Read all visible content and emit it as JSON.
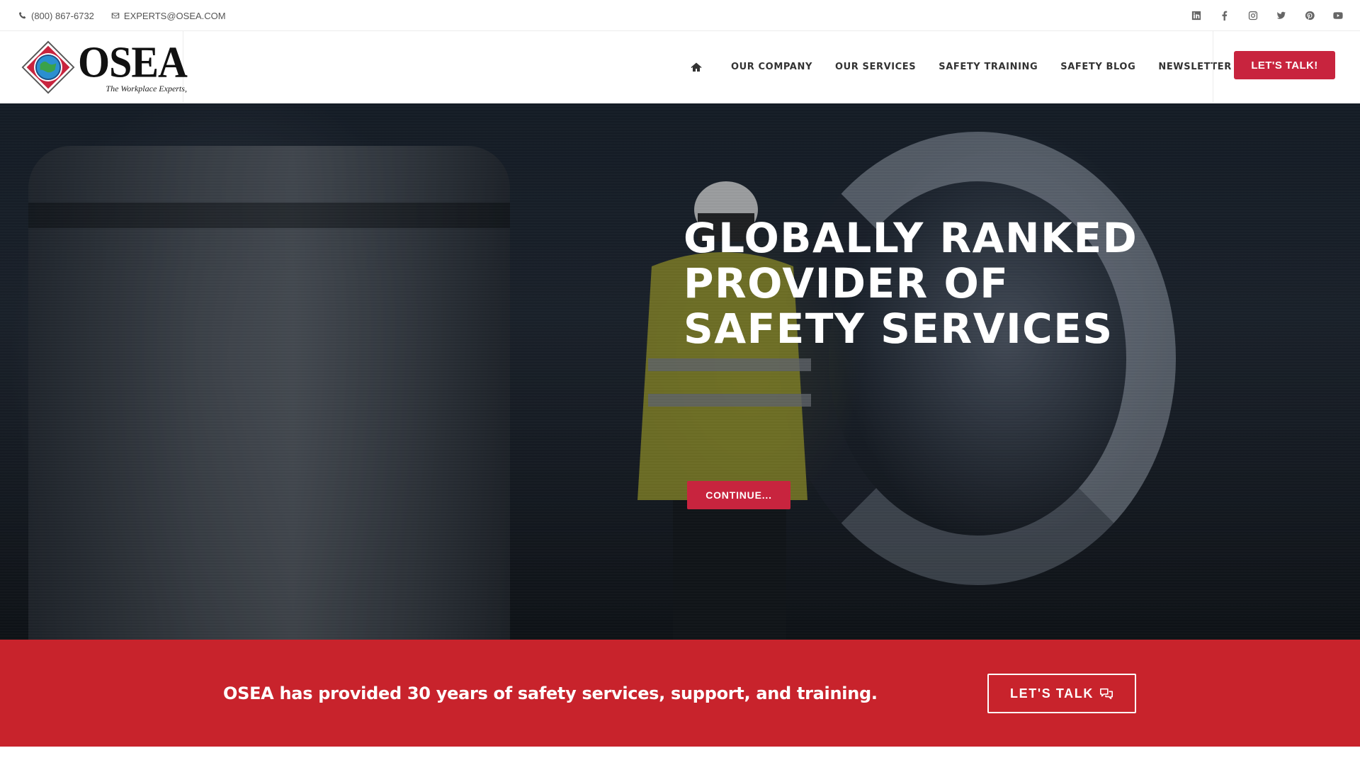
{
  "topbar": {
    "phone": "(800) 867-6732",
    "email": "EXPERTS@OSEA.COM",
    "social": [
      "linkedin-icon",
      "facebook-icon",
      "instagram-icon",
      "twitter-icon",
      "pinterest-icon",
      "youtube-icon"
    ]
  },
  "header": {
    "logo_text": "OSEA",
    "logo_tagline": "The Workplace Experts,",
    "nav": [
      "OUR COMPANY",
      "OUR SERVICES",
      "SAFETY TRAINING",
      "SAFETY BLOG",
      "NEWSLETTER"
    ],
    "cta_label": "LET'S TALK!"
  },
  "hero": {
    "title_lines": [
      "GLOBALLY RANKED",
      "PROVIDER OF",
      "SAFETY SERVICES"
    ],
    "button_label": "CONTINUE..."
  },
  "banner": {
    "message": "OSEA has provided 30 years of safety services, support, and training.",
    "button_label": "LET'S TALK"
  },
  "colors": {
    "accent": "#c8243e",
    "banner": "#c8232c",
    "text_dark": "#333333"
  }
}
